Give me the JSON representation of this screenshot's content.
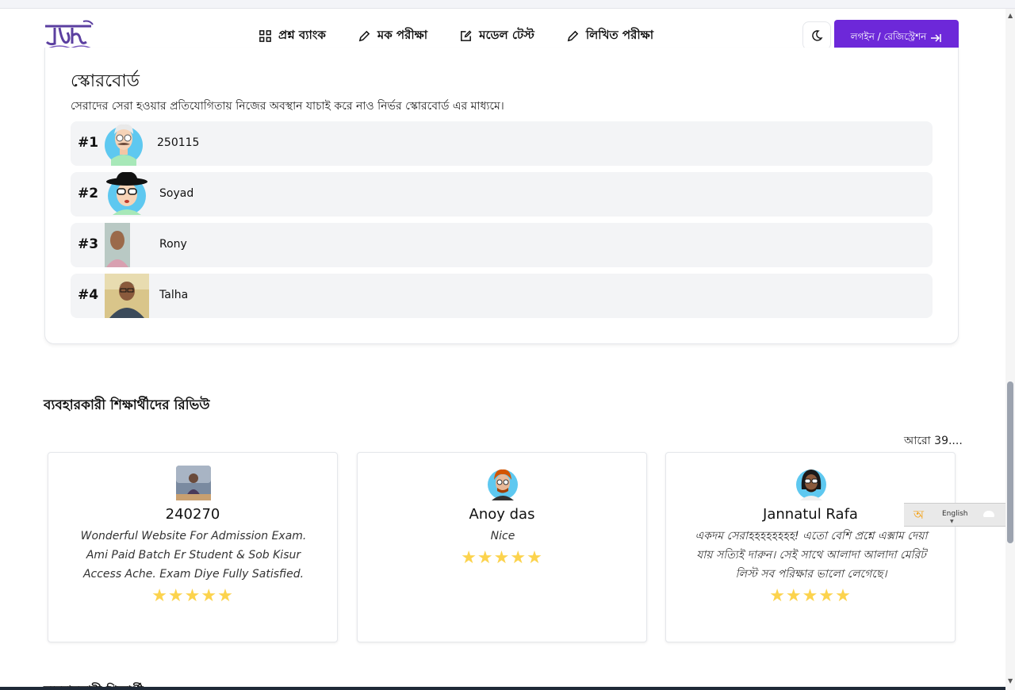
{
  "nav": {
    "items": [
      {
        "label": "প্রশ্ন ব্যাংক",
        "icon": "grid-icon"
      },
      {
        "label": "মক পরীক্ষা",
        "icon": "pencil-icon"
      },
      {
        "label": "মডেল টেস্ট",
        "icon": "edit-square-icon"
      },
      {
        "label": "লিখিত পরীক্ষা",
        "icon": "pencil-icon"
      }
    ],
    "login_label": "লগইন / রেজিস্ট্রেশন"
  },
  "scoreboard": {
    "title": "স্কোরবোর্ড",
    "subtitle": "সেরাদের সেরা হওয়ার প্রতিযোগিতায় নিজের অবস্থান যাচাই করে নাও নির্ভর স্কোরবোর্ড এর মাধ্যমে।",
    "rows": [
      {
        "rank": "#1",
        "name": "250115"
      },
      {
        "rank": "#2",
        "name": "Soyad"
      },
      {
        "rank": "#3",
        "name": "Rony"
      },
      {
        "rank": "#4",
        "name": "Talha"
      }
    ]
  },
  "reviews": {
    "title": "ব্যবহারকারী শিক্ষার্থীদের রিভিউ",
    "more": "আরো 39....",
    "items": [
      {
        "name": "240270",
        "text": "Wonderful Website For Admission Exam. Ami Paid Batch Er Student & Sob Kisur Access Ache. Exam Diye Fully Satisfied.",
        "stars": "★★★★★"
      },
      {
        "name": "Anoy das",
        "text": "Nice",
        "stars": "★★★★★"
      },
      {
        "name": "Jannatul Rafa",
        "text": "একদম সেরাহহহহহহহহ! এতো বেশি প্রশ্নে এক্সাম দেয়া যায় সত্যিই দারুন। সেই সাথে আলাদা আলাদা মেরিট লিস্ট সব পরিক্ষার ভালো লেগেছে।",
        "stars": "★★★★★"
      }
    ]
  },
  "footer_cut_text": "ব্যবহারকারী শিক্ষার্থী",
  "language_widget": {
    "bn_label": "অ",
    "en_label": "English"
  },
  "colors": {
    "accent": "#6d28d9",
    "star": "#fcd34d",
    "row_bg": "#f3f4f6"
  }
}
